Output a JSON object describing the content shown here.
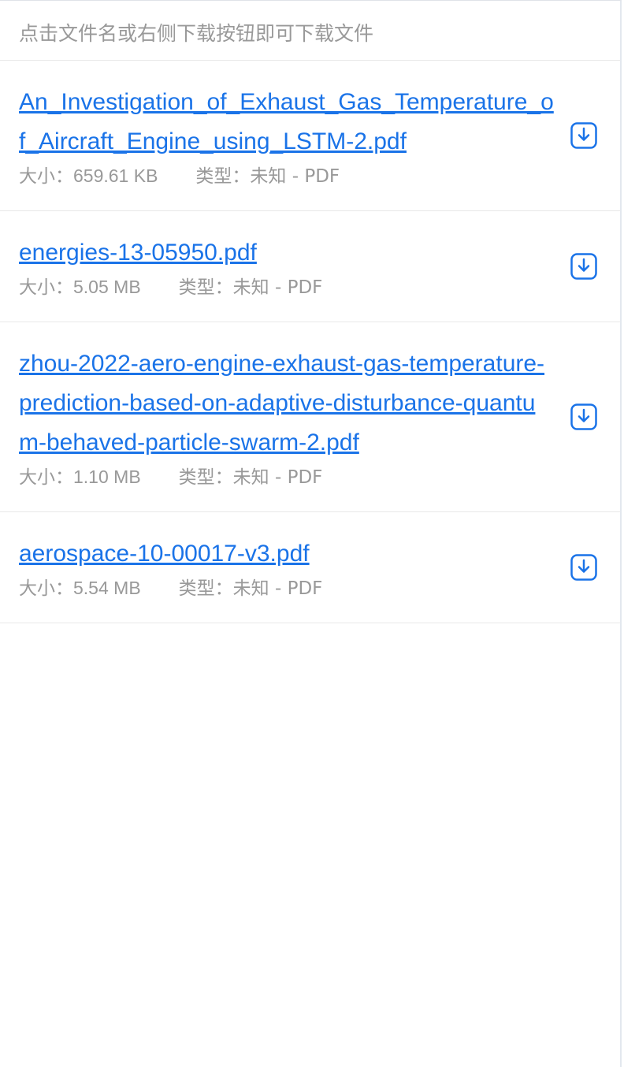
{
  "hint": "点击文件名或右侧下载按钮即可下载文件",
  "colors": {
    "link": "#1a73e8",
    "meta": "#999999",
    "icon": "#1a73e8",
    "divider": "#e8e8e8"
  },
  "files": [
    {
      "name": "An_Investigation_of_Exhaust_Gas_Temperature_of_Aircraft_Engine_using_LSTM-2.pdf",
      "size_label": "大小：",
      "size": "659.61 KB",
      "type_label": "类型：",
      "type": "未知 - PDF",
      "icon": "download-icon"
    },
    {
      "name": "energies-13-05950.pdf",
      "size_label": "大小：",
      "size": "5.05 MB",
      "type_label": "类型：",
      "type": "未知 - PDF",
      "icon": "download-icon"
    },
    {
      "name": "zhou-2022-aero-engine-exhaust-gas-temperature-prediction-based-on-adaptive-disturbance-quantum-behaved-particle-swarm-2.pdf",
      "size_label": "大小：",
      "size": "1.10 MB",
      "type_label": "类型：",
      "type": "未知 - PDF",
      "icon": "download-icon"
    },
    {
      "name": "aerospace-10-00017-v3.pdf",
      "size_label": "大小：",
      "size": "5.54 MB",
      "type_label": "类型：",
      "type": "未知 - PDF",
      "icon": "download-icon"
    }
  ]
}
